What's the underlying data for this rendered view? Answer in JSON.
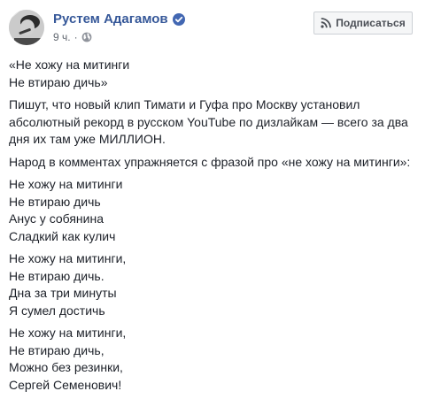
{
  "post": {
    "author": "Рустем Адагамов",
    "time": "9 ч.",
    "dot": "·",
    "subscribe_label": "Подписаться",
    "icons": {
      "verified": "verified-badge-icon",
      "privacy": "globe-icon",
      "subscribe": "rss-icon"
    },
    "colors": {
      "author": "#365899",
      "verified": "#4267b2",
      "meta": "#616770",
      "text": "#1d2129"
    },
    "paragraphs": [
      [
        "«Не хожу на митинги",
        "Не втираю дичь»"
      ],
      [
        "Пишут, что новый клип Тимати и Гуфа про Москву установил",
        "абсолютный рекорд в русском YouTube по дизлайкам — всего за два",
        "дня их там уже МИЛЛИОН."
      ],
      [
        "Народ в комментах упражняется с фразой про «не хожу на митинги»:"
      ],
      [
        "Не хожу на митинги",
        "Не втираю дичь",
        "Анус у собянина",
        "Сладкий как кулич"
      ],
      [
        "Не хожу на митинги,",
        "Не втираю дичь.",
        "Дна за три минуты",
        "Я сумел достичь"
      ],
      [
        "Не хожу на митинги,",
        "Не втираю дичь,",
        "Можно без резинки,",
        "Сергей Семенович!"
      ]
    ]
  }
}
